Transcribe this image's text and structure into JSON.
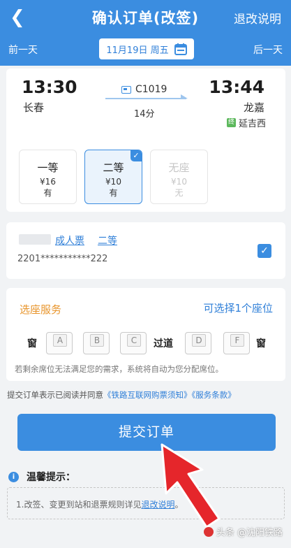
{
  "header": {
    "title": "确认订单(改签)",
    "rules_link": "退改说明",
    "prev_day": "前一天",
    "next_day": "后一天",
    "date": "11月19日 周五"
  },
  "train": {
    "departure_time": "13:30",
    "departure_station": "长春",
    "arrival_time": "13:44",
    "arrival_station": "龙嘉",
    "train_number": "C1019",
    "duration": "14分",
    "via_badge": "终",
    "via_station": "延吉西"
  },
  "seat_options": [
    {
      "name": "一等",
      "price": "¥16",
      "availability": "有",
      "state": "normal"
    },
    {
      "name": "二等",
      "price": "¥10",
      "availability": "有",
      "state": "selected"
    },
    {
      "name": "无座",
      "price": "¥10",
      "availability": "无",
      "state": "disabled"
    }
  ],
  "passenger": {
    "ticket_type": "成人票",
    "seat_class": "二等",
    "id_number": "2201***********222",
    "checked": true
  },
  "seat_service": {
    "title": "选座服务",
    "hint": "可选择1个座位",
    "window_left": "窗",
    "aisle": "过道",
    "window_right": "窗",
    "seats": [
      "A",
      "B",
      "C",
      "D",
      "F"
    ],
    "note": "若剩余席位无法满足您的需求，系统将自动为您分配席位。"
  },
  "agreement": {
    "prefix": "提交订单表示已阅读并同意",
    "link1": "《铁路互联网购票须知》",
    "link2": "《服务条款》"
  },
  "submit_label": "提交订单",
  "tips": {
    "title": "温馨提示：",
    "text_prefix": "1.改签、变更到站和退票规则详见",
    "text_link": "退改说明",
    "text_suffix": "。"
  },
  "watermark": "头条 @沈阳铁路",
  "colors": {
    "primary": "#3b8de0",
    "accent_orange": "#e8952c",
    "pointer_red": "#e5262b"
  }
}
